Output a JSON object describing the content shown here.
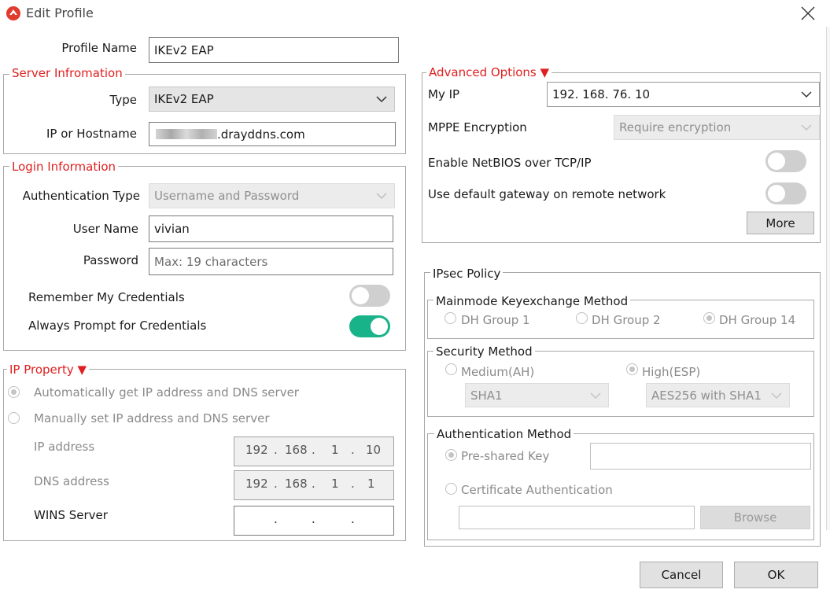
{
  "window": {
    "title": "Edit Profile"
  },
  "profile_name": {
    "label": "Profile Name",
    "value": "IKEv2 EAP"
  },
  "server": {
    "legend": "Server Infromation",
    "type_label": "Type",
    "type_value": "IKEv2 EAP",
    "host_label": "IP or Hostname",
    "host_value": ".drayddns.com"
  },
  "login": {
    "legend": "Login Information",
    "auth_type_label": "Authentication Type",
    "auth_type_value": "Username and Password",
    "username_label": "User Name",
    "username_value": "vivian",
    "password_label": "Password",
    "password_placeholder": "Max: 19 characters",
    "remember_label": "Remember My Credentials",
    "remember_on": false,
    "prompt_label": "Always Prompt for Credentials",
    "prompt_on": true
  },
  "ip_property": {
    "legend": "IP Property ▼",
    "auto_label": "Automatically get IP address and DNS server",
    "manual_label": "Manually set IP address and DNS server",
    "ip_label": "IP address",
    "ip_octets": [
      "192",
      ".",
      "168",
      ".",
      "1",
      ".",
      "10"
    ],
    "dns_label": "DNS address",
    "dns_octets": [
      "192",
      ".",
      "168",
      ".",
      "1",
      ".",
      "1"
    ],
    "wins_label": "WINS Server",
    "wins_dots": [
      ".",
      ".",
      "."
    ]
  },
  "advanced": {
    "legend": "Advanced Options ▼",
    "myip_label": "My IP",
    "myip_value": "192. 168. 76. 10",
    "mppe_label": "MPPE Encryption",
    "mppe_value": "Require encryption",
    "netbios_label": "Enable NetBIOS over TCP/IP",
    "netbios_on": false,
    "gateway_label": "Use default gateway on remote network",
    "gateway_on": false,
    "more_button": "More"
  },
  "ipsec": {
    "legend": "IPsec Policy",
    "mainmode": {
      "legend": "Mainmode Keyexchange Method",
      "options": [
        "DH Group 1",
        "DH Group 2",
        "DH Group 14"
      ],
      "selected": "DH Group 14"
    },
    "security": {
      "legend": "Security Method",
      "medium_label": "Medium(AH)",
      "high_label": "High(ESP)",
      "selected": "High(ESP)",
      "medium_select": "SHA1",
      "high_select": "AES256 with SHA1"
    },
    "auth": {
      "legend": "Authentication Method",
      "psk_label": "Pre-shared Key",
      "cert_label": "Certificate Authentication",
      "selected": "Pre-shared Key",
      "browse_button": "Browse"
    }
  },
  "buttons": {
    "cancel": "Cancel",
    "ok": "OK"
  },
  "colors": {
    "accent_red": "#e02020",
    "toggle_on": "#19b38a",
    "toggle_off": "#cfcfcf"
  }
}
